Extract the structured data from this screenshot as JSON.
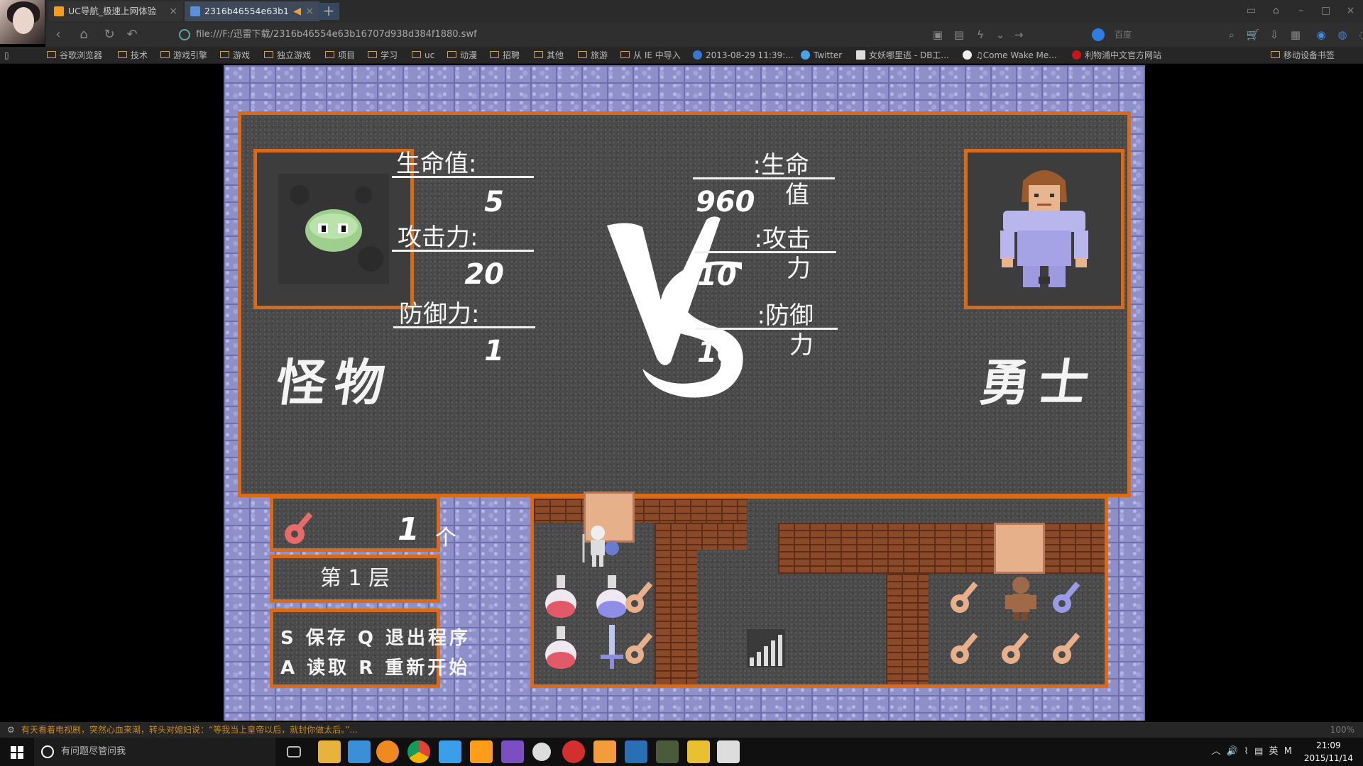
{
  "browser": {
    "tabs": [
      {
        "label": "UC导航_极速上网体验",
        "active": false
      },
      {
        "label": "2316b46554e63b1",
        "active": true
      }
    ],
    "url": "file:///F:/迅雷下载/2316b46554e63b16707d938d384f1880.swf",
    "search_placeholder": "百度",
    "bookmarks": [
      "谷歌浏览器",
      "技术",
      "游戏引擎",
      "游戏",
      "独立游戏",
      "项目",
      "学习",
      "uc",
      "动漫",
      "招聘",
      "其他",
      "旅游",
      "从 IE 中导入",
      "2013-08-29 11:39:...",
      "Twitter",
      "女妖哪里逃 - DB工...",
      "♫Come Wake Me...",
      "利物浦中文官方网站",
      "移动设备书签"
    ]
  },
  "battle": {
    "monster": {
      "name": "怪物",
      "hp_label": "生命值:",
      "hp": "5",
      "atk_label": "攻击力:",
      "atk": "20",
      "def_label": "防御力:",
      "def": "1"
    },
    "hero": {
      "name": "勇士",
      "hp_label": ":生命值",
      "hp": "960",
      "atk_label": ":攻击力",
      "atk": "10",
      "def_label": ":防御力",
      "def": "10"
    }
  },
  "hud": {
    "key_count": "1",
    "key_unit": "个",
    "floor": "第 1 层",
    "help": [
      "S 保存  Q 退出程序",
      "A 读取  R 重新开始"
    ]
  },
  "status": {
    "ticker": "有天看着电视剧，突然心血来潮，转头对媳妇说：“等我当上皇帝以后，就封你做太后。”...",
    "zoom": "100%"
  },
  "taskbar": {
    "search_placeholder": "有问题尽管问我",
    "time": "21:09",
    "date": "2015/11/14",
    "ime": "英"
  },
  "colors": {
    "frame": "#d96a17",
    "wall": "#8f90c9",
    "floor": "#4a4a4a"
  }
}
